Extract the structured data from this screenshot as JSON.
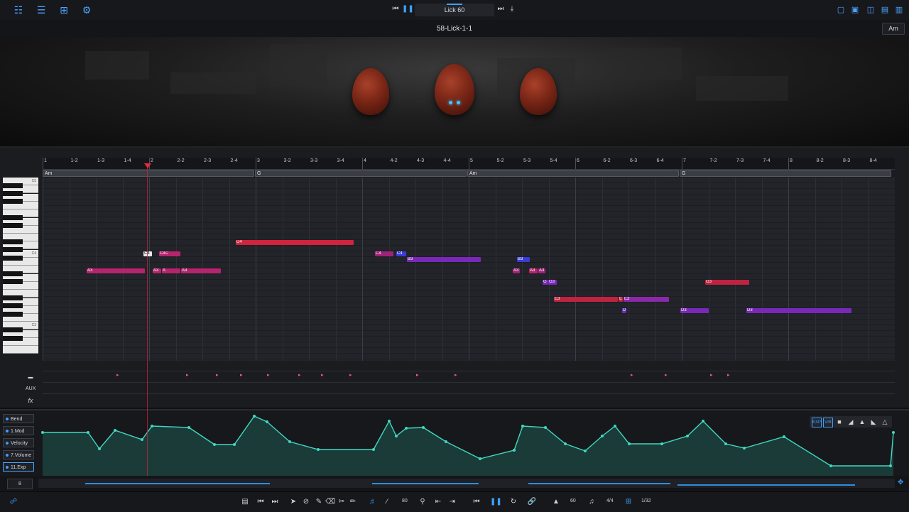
{
  "topbar": {
    "left_icons": [
      "piano-roll-icon",
      "track-list-icon",
      "mixer-sliders-icon",
      "settings-gear-icon"
    ],
    "lick_name": "Lick 60",
    "right_icons": [
      "view-1-icon",
      "view-2-icon",
      "view-3-icon",
      "view-4-icon",
      "view-5-icon"
    ]
  },
  "titlebar": {
    "title": "58-Lick-1-1",
    "key": "Am"
  },
  "ruler": {
    "labels": [
      "1",
      "1-2",
      "1-3",
      "1-4",
      "2",
      "2-2",
      "2-3",
      "2-4",
      "3",
      "3-2",
      "3-3",
      "3-4",
      "4",
      "4-2",
      "4-3",
      "4-4",
      "5",
      "5-2",
      "5-3",
      "5-4",
      "6",
      "6-2",
      "6-3",
      "6-4",
      "7",
      "7-2",
      "7-3",
      "7-4",
      "8",
      "8-2",
      "8-3",
      "8-4"
    ]
  },
  "chords": [
    {
      "label": "Am"
    },
    {
      "label": "G"
    },
    {
      "label": "Am"
    },
    {
      "label": "G"
    }
  ],
  "keyboard": {
    "labels": [
      "C5",
      "C4",
      "C3"
    ]
  },
  "notes": [
    {
      "label": "D4",
      "color": "#d0233d"
    },
    {
      "label": "C4",
      "color": "#e8e8e8"
    },
    {
      "label": "C4",
      "color": "#b5246e"
    },
    {
      "label": "C",
      "color": "#b5246e"
    },
    {
      "label": "A3",
      "color": "#b5246e"
    },
    {
      "label": "A3",
      "color": "#b5246e"
    },
    {
      "label": "A",
      "color": "#b5246e"
    },
    {
      "label": "A3",
      "color": "#b5246e"
    },
    {
      "label": "C4",
      "color": "#a0237a"
    },
    {
      "label": "C4",
      "color": "#3b3bd6"
    },
    {
      "label": "B3",
      "color": "#7a28b8"
    },
    {
      "label": "B3",
      "color": "#3b3bd6"
    },
    {
      "label": "A3",
      "color": "#a0237a"
    },
    {
      "label": "A3",
      "color": "#b5246e"
    },
    {
      "label": "A3",
      "color": "#a0237a"
    },
    {
      "label": "G",
      "color": "#7a28b8"
    },
    {
      "label": "G3",
      "color": "#7a28b8"
    },
    {
      "label": "E3",
      "color": "#c0233f"
    },
    {
      "label": "E",
      "color": "#c0233f"
    },
    {
      "label": "E3",
      "color": "#8a2aa8"
    },
    {
      "label": "D",
      "color": "#6c2ab8"
    },
    {
      "label": "D3",
      "color": "#7a28b8"
    },
    {
      "label": "D3",
      "color": "#7a28b8"
    },
    {
      "label": "G3",
      "color": "#c0233f"
    }
  ],
  "lanes": {
    "icons": [
      "articulation-lane-icon",
      "aux-lane-icon",
      "fx-lane-icon"
    ],
    "aux_label": "AUX",
    "fx_label": "fx"
  },
  "automation": {
    "cc_buttons": [
      "Bend",
      "1.Mod",
      "Velocity",
      "7.Volume",
      "11.Exp"
    ],
    "active": "11.Exp",
    "tools": [
      "EXP",
      "VIB",
      "square-shape-icon",
      "ramp-shape-icon",
      "arch-shape-icon",
      "attack-shape-icon",
      "peak-shape-icon"
    ],
    "curve_color": "#3fd9c0"
  },
  "overview": {
    "lane_number": "8"
  },
  "bottombar": {
    "tempo": "80",
    "bpm": "60",
    "time_signature": "4/4",
    "grid": "1/32"
  }
}
